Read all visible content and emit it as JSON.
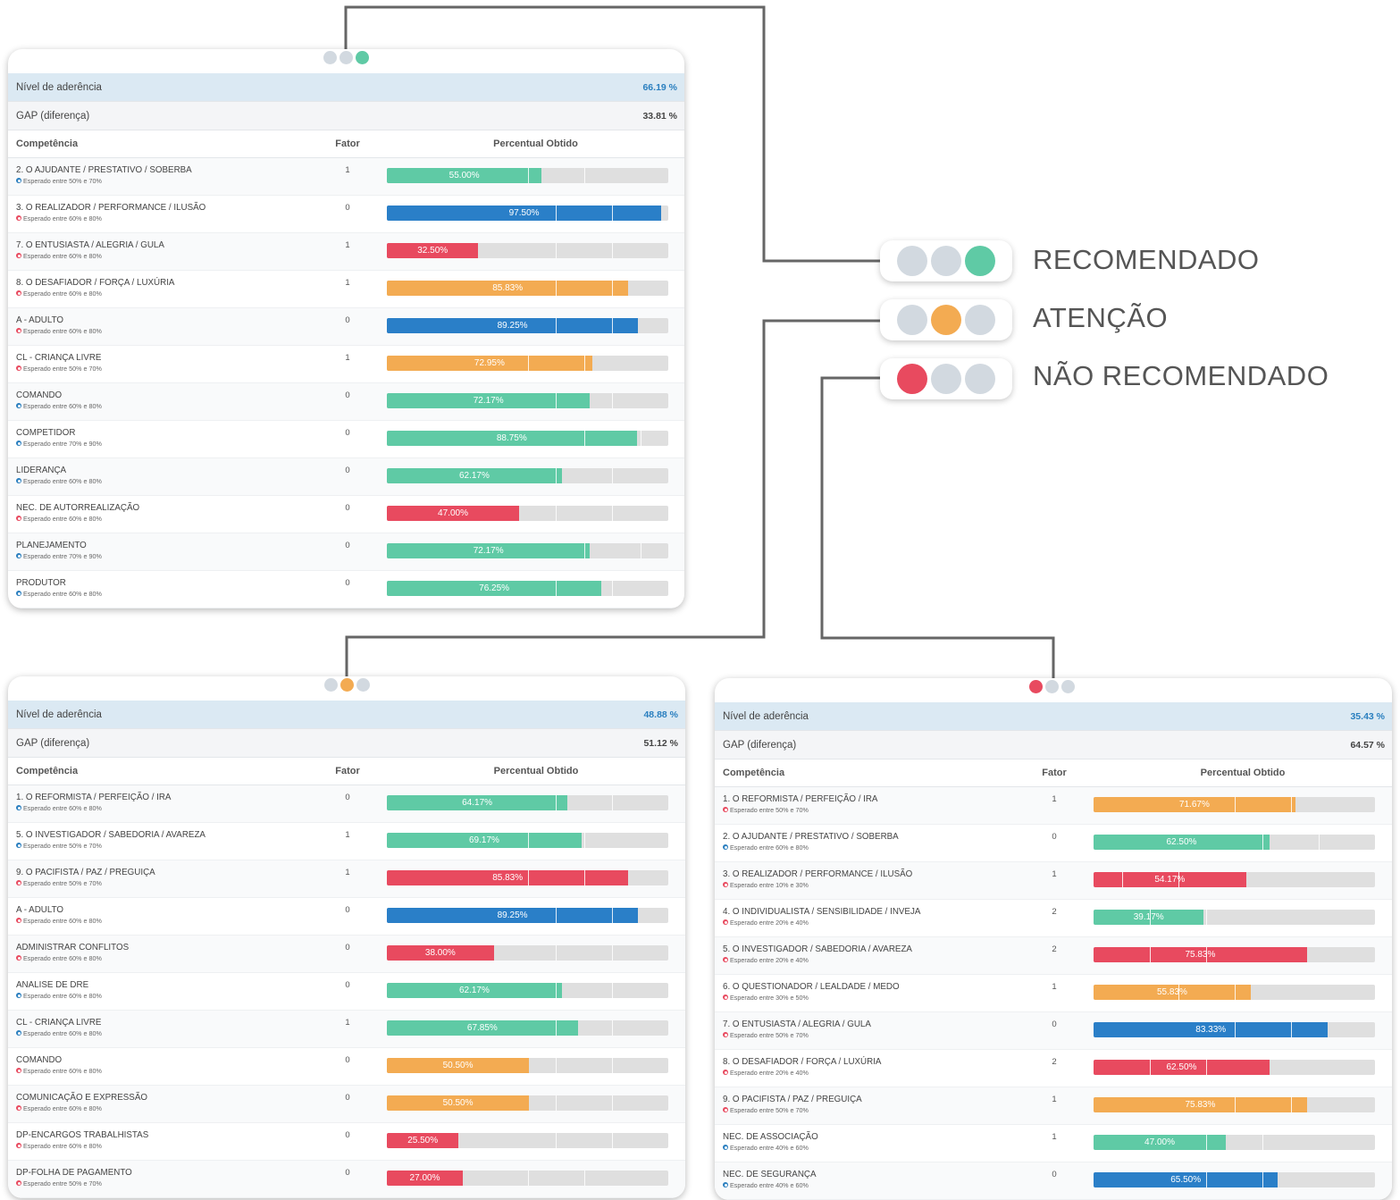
{
  "colors": {
    "green": "#5fcaa5",
    "orange": "#f3ab52",
    "red": "#e84a5f",
    "blue": "#2a7fc8",
    "grey": "#d2d9e0"
  },
  "legend": [
    {
      "label": "RECOMENDADO",
      "lit": 2,
      "lit_color": "green"
    },
    {
      "label": "ATENÇÃO",
      "lit": 1,
      "lit_color": "orange"
    },
    {
      "label": "NÃO RECOMENDADO",
      "lit": 0,
      "lit_color": "red"
    }
  ],
  "cards": [
    {
      "indicator": {
        "lit": 2,
        "lit_color": "green"
      },
      "aderencia_label": "Nível de aderência",
      "aderencia_value": "66.19 %",
      "gap_label": "GAP (diferença)",
      "gap_value": "33.81 %",
      "headers": {
        "competencia": "Competência",
        "fator": "Fator",
        "percentual": "Percentual Obtido"
      },
      "rows": [
        {
          "name": "2. O AJUDANTE / PRESTATIVO / SOBERBA",
          "expected": "Esperado entre 50% e 70%",
          "exp_ok": true,
          "fator": "1",
          "value": 55.0,
          "label": "55.00%",
          "color": "green",
          "marks": [
            50,
            70
          ]
        },
        {
          "name": "3. O REALIZADOR / PERFORMANCE / ILUSÃO",
          "expected": "Esperado entre 60% e 80%",
          "exp_ok": false,
          "fator": "0",
          "value": 97.5,
          "label": "97.50%",
          "color": "blue",
          "marks": [
            60,
            80
          ]
        },
        {
          "name": "7. O ENTUSIASTA / ALEGRIA / GULA",
          "expected": "Esperado entre 60% e 80%",
          "exp_ok": false,
          "fator": "1",
          "value": 32.5,
          "label": "32.50%",
          "color": "red",
          "marks": [
            60,
            80
          ]
        },
        {
          "name": "8. O DESAFIADOR / FORÇA / LUXÚRIA",
          "expected": "Esperado entre 60% e 80%",
          "exp_ok": false,
          "fator": "1",
          "value": 85.83,
          "label": "85.83%",
          "color": "orange",
          "marks": [
            60,
            80
          ]
        },
        {
          "name": "A - ADULTO",
          "expected": "Esperado entre 60% e 80%",
          "exp_ok": false,
          "fator": "0",
          "value": 89.25,
          "label": "89.25%",
          "color": "blue",
          "marks": [
            60,
            80
          ]
        },
        {
          "name": "CL - CRIANÇA LIVRE",
          "expected": "Esperado entre 50% e 70%",
          "exp_ok": false,
          "fator": "1",
          "value": 72.95,
          "label": "72.95%",
          "color": "orange",
          "marks": [
            50,
            70
          ]
        },
        {
          "name": "COMANDO",
          "expected": "Esperado entre 60% e 80%",
          "exp_ok": true,
          "fator": "0",
          "value": 72.17,
          "label": "72.17%",
          "color": "green",
          "marks": [
            60,
            80
          ]
        },
        {
          "name": "COMPETIDOR",
          "expected": "Esperado entre 70% e 90%",
          "exp_ok": true,
          "fator": "0",
          "value": 88.75,
          "label": "88.75%",
          "color": "green",
          "marks": [
            70,
            90
          ]
        },
        {
          "name": "LIDERANÇA",
          "expected": "Esperado entre 60% e 80%",
          "exp_ok": true,
          "fator": "0",
          "value": 62.17,
          "label": "62.17%",
          "color": "green",
          "marks": [
            60,
            80
          ]
        },
        {
          "name": "NEC. DE AUTORREALIZAÇÃO",
          "expected": "Esperado entre 60% e 80%",
          "exp_ok": false,
          "fator": "0",
          "value": 47.0,
          "label": "47.00%",
          "color": "red",
          "marks": [
            60,
            80
          ]
        },
        {
          "name": "PLANEJAMENTO",
          "expected": "Esperado entre 70% e 90%",
          "exp_ok": true,
          "fator": "0",
          "value": 72.17,
          "label": "72.17%",
          "color": "green",
          "marks": [
            70,
            90
          ]
        },
        {
          "name": "PRODUTOR",
          "expected": "Esperado entre 60% e 80%",
          "exp_ok": true,
          "fator": "0",
          "value": 76.25,
          "label": "76.25%",
          "color": "green",
          "marks": [
            60,
            80
          ]
        }
      ]
    },
    {
      "indicator": {
        "lit": 1,
        "lit_color": "orange"
      },
      "aderencia_label": "Nível de aderência",
      "aderencia_value": "48.88 %",
      "gap_label": "GAP (diferença)",
      "gap_value": "51.12 %",
      "headers": {
        "competencia": "Competência",
        "fator": "Fator",
        "percentual": "Percentual Obtido"
      },
      "rows": [
        {
          "name": "1. O REFORMISTA / PERFEIÇÃO / IRA",
          "expected": "Esperado entre 60% e 80%",
          "exp_ok": true,
          "fator": "0",
          "value": 64.17,
          "label": "64.17%",
          "color": "green",
          "marks": [
            60,
            80
          ]
        },
        {
          "name": "5. O INVESTIGADOR / SABEDORIA / AVAREZA",
          "expected": "Esperado entre 50% e 70%",
          "exp_ok": true,
          "fator": "1",
          "value": 69.17,
          "label": "69.17%",
          "color": "green",
          "marks": [
            50,
            70
          ]
        },
        {
          "name": "9. O PACIFISTA / PAZ / PREGUIÇA",
          "expected": "Esperado entre 50% e 70%",
          "exp_ok": false,
          "fator": "1",
          "value": 85.83,
          "label": "85.83%",
          "color": "red",
          "marks": [
            50,
            70
          ]
        },
        {
          "name": "A - ADULTO",
          "expected": "Esperado entre 60% e 80%",
          "exp_ok": false,
          "fator": "0",
          "value": 89.25,
          "label": "89.25%",
          "color": "blue",
          "marks": [
            60,
            80
          ]
        },
        {
          "name": "ADMINISTRAR CONFLITOS",
          "expected": "Esperado entre 60% e 80%",
          "exp_ok": false,
          "fator": "0",
          "value": 38.0,
          "label": "38.00%",
          "color": "red",
          "marks": [
            60,
            80
          ]
        },
        {
          "name": "ANALISE DE DRE",
          "expected": "Esperado entre 60% e 80%",
          "exp_ok": true,
          "fator": "0",
          "value": 62.17,
          "label": "62.17%",
          "color": "green",
          "marks": [
            60,
            80
          ]
        },
        {
          "name": "CL - CRIANÇA LIVRE",
          "expected": "Esperado entre 60% e 80%",
          "exp_ok": true,
          "fator": "1",
          "value": 67.85,
          "label": "67.85%",
          "color": "green",
          "marks": [
            60,
            80
          ]
        },
        {
          "name": "COMANDO",
          "expected": "Esperado entre 60% e 80%",
          "exp_ok": false,
          "fator": "0",
          "value": 50.5,
          "label": "50.50%",
          "color": "orange",
          "marks": [
            60,
            80
          ]
        },
        {
          "name": "COMUNICAÇÃO E EXPRESSÃO",
          "expected": "Esperado entre 60% e 80%",
          "exp_ok": false,
          "fator": "0",
          "value": 50.5,
          "label": "50.50%",
          "color": "orange",
          "marks": [
            60,
            80
          ]
        },
        {
          "name": "DP-ENCARGOS TRABALHISTAS",
          "expected": "Esperado entre 60% e 80%",
          "exp_ok": false,
          "fator": "0",
          "value": 25.5,
          "label": "25.50%",
          "color": "red",
          "marks": [
            60,
            80
          ]
        },
        {
          "name": "DP-FOLHA DE PAGAMENTO",
          "expected": "Esperado entre 50% e 70%",
          "exp_ok": false,
          "fator": "0",
          "value": 27.0,
          "label": "27.00%",
          "color": "red",
          "marks": [
            50,
            70
          ]
        }
      ]
    },
    {
      "indicator": {
        "lit": 0,
        "lit_color": "red"
      },
      "aderencia_label": "Nível de aderência",
      "aderencia_value": "35.43 %",
      "gap_label": "GAP (diferença)",
      "gap_value": "64.57 %",
      "headers": {
        "competencia": "Competência",
        "fator": "Fator",
        "percentual": "Percentual Obtido"
      },
      "rows": [
        {
          "name": "1. O REFORMISTA / PERFEIÇÃO / IRA",
          "expected": "Esperado entre 50% e 70%",
          "exp_ok": false,
          "fator": "1",
          "value": 71.67,
          "label": "71.67%",
          "color": "orange",
          "marks": [
            50,
            70
          ]
        },
        {
          "name": "2. O AJUDANTE / PRESTATIVO / SOBERBA",
          "expected": "Esperado entre 60% e 80%",
          "exp_ok": true,
          "fator": "0",
          "value": 62.5,
          "label": "62.50%",
          "color": "green",
          "marks": [
            60,
            80
          ]
        },
        {
          "name": "3. O REALIZADOR / PERFORMANCE / ILUSÃO",
          "expected": "Esperado entre 10% e 30%",
          "exp_ok": false,
          "fator": "1",
          "value": 54.17,
          "label": "54.17%",
          "color": "red",
          "marks": [
            10,
            30
          ]
        },
        {
          "name": "4. O INDIVIDUALISTA / SENSIBILIDADE / INVEJA",
          "expected": "Esperado entre 20% e 40%",
          "exp_ok": false,
          "fator": "2",
          "value": 39.17,
          "label": "39.17%",
          "color": "green",
          "marks": [
            20,
            40
          ]
        },
        {
          "name": "5. O INVESTIGADOR / SABEDORIA / AVAREZA",
          "expected": "Esperado entre 20% e 40%",
          "exp_ok": false,
          "fator": "2",
          "value": 75.83,
          "label": "75.83%",
          "color": "red",
          "marks": [
            20,
            40
          ]
        },
        {
          "name": "6. O QUESTIONADOR / LEALDADE / MEDO",
          "expected": "Esperado entre 30% e 50%",
          "exp_ok": false,
          "fator": "1",
          "value": 55.83,
          "label": "55.83%",
          "color": "orange",
          "marks": [
            30,
            50
          ]
        },
        {
          "name": "7. O ENTUSIASTA / ALEGRIA / GULA",
          "expected": "Esperado entre 50% e 70%",
          "exp_ok": false,
          "fator": "0",
          "value": 83.33,
          "label": "83.33%",
          "color": "blue",
          "marks": [
            50,
            70
          ]
        },
        {
          "name": "8. O DESAFIADOR / FORÇA / LUXÚRIA",
          "expected": "Esperado entre 20% e 40%",
          "exp_ok": false,
          "fator": "2",
          "value": 62.5,
          "label": "62.50%",
          "color": "red",
          "marks": [
            20,
            40
          ]
        },
        {
          "name": "9. O PACIFISTA / PAZ / PREGUIÇA",
          "expected": "Esperado entre 50% e 70%",
          "exp_ok": false,
          "fator": "1",
          "value": 75.83,
          "label": "75.83%",
          "color": "orange",
          "marks": [
            50,
            70
          ]
        },
        {
          "name": "NEC. DE ASSOCIAÇÃO",
          "expected": "Esperado entre 40% e 60%",
          "exp_ok": true,
          "fator": "1",
          "value": 47.0,
          "label": "47.00%",
          "color": "green",
          "marks": [
            40,
            60
          ]
        },
        {
          "name": "NEC. DE SEGURANÇA",
          "expected": "Esperado entre 40% e 60%",
          "exp_ok": true,
          "fator": "0",
          "value": 65.5,
          "label": "65.50%",
          "color": "blue",
          "marks": [
            40,
            60
          ]
        }
      ]
    }
  ]
}
